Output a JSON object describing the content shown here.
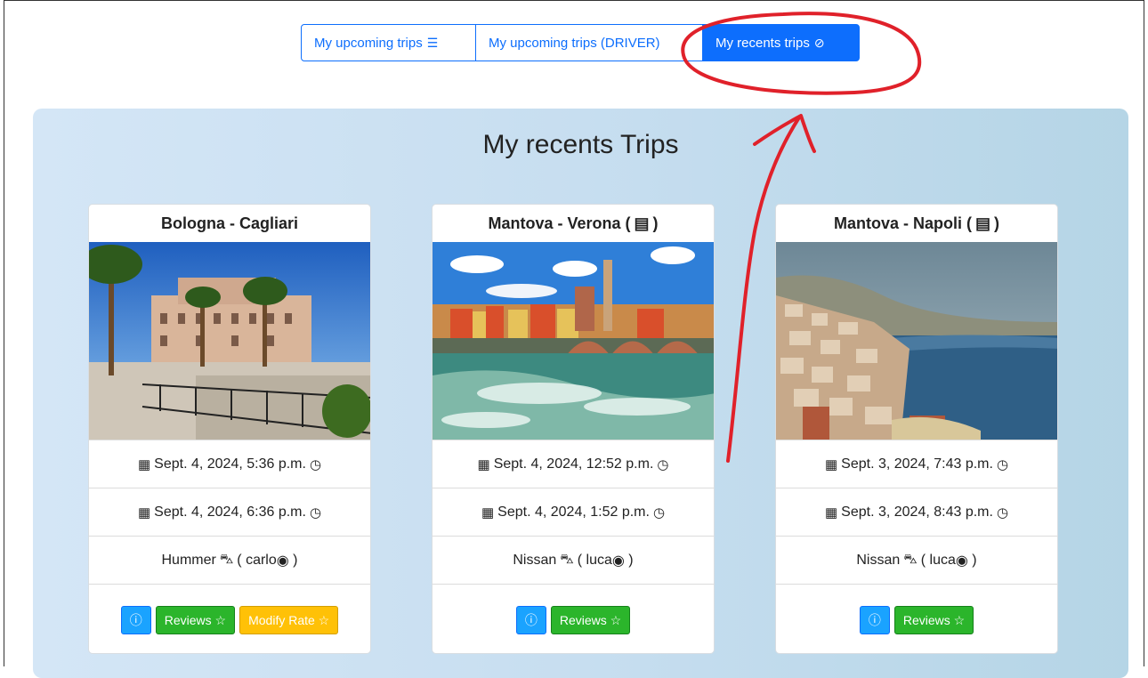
{
  "tabs": [
    {
      "label": "My upcoming trips",
      "icon": "list-icon",
      "glyph": "☰"
    },
    {
      "label": "My upcoming trips (DRIVER)"
    },
    {
      "label": "My recents trips",
      "icon": "check-circle-icon",
      "glyph": "⊘"
    }
  ],
  "panel": {
    "title": "My recents Trips"
  },
  "cards": [
    {
      "title": "Bologna - Cagliari",
      "start": "Sept. 4, 2024, 5:36 p.m.",
      "end": "Sept. 4, 2024, 6:36 p.m.",
      "car": "Hummer",
      "driver": "carlo",
      "buttons": {
        "info": "ⓘ",
        "reviews": "Reviews ☆",
        "modify": "Modify Rate ☆"
      }
    },
    {
      "title": "Mantova - Verona (",
      "title_suffix": ")",
      "start": "Sept. 4, 2024, 12:52 p.m.",
      "end": "Sept. 4, 2024, 1:52 p.m.",
      "car": "Nissan",
      "driver": "luca",
      "buttons": {
        "info": "ⓘ",
        "reviews": "Reviews ☆"
      }
    },
    {
      "title": "Mantova - Napoli (",
      "title_suffix": ")",
      "start": "Sept. 3, 2024, 7:43 p.m.",
      "end": "Sept. 3, 2024, 8:43 p.m.",
      "car": "Nissan",
      "driver": "luca",
      "buttons": {
        "info": "ⓘ",
        "reviews": "Reviews ☆"
      }
    }
  ],
  "glyphs": {
    "calendar": "▦",
    "clock": "◷",
    "car": "⛍",
    "user": "◉",
    "open_paren": "( ",
    "close_paren": " )",
    "idcard": "▤"
  },
  "colors": {
    "primary": "#0d6efd",
    "info": "#1aa3ff",
    "success": "#2bb52b",
    "warning": "#ffc107",
    "annotation": "#e0212a"
  }
}
